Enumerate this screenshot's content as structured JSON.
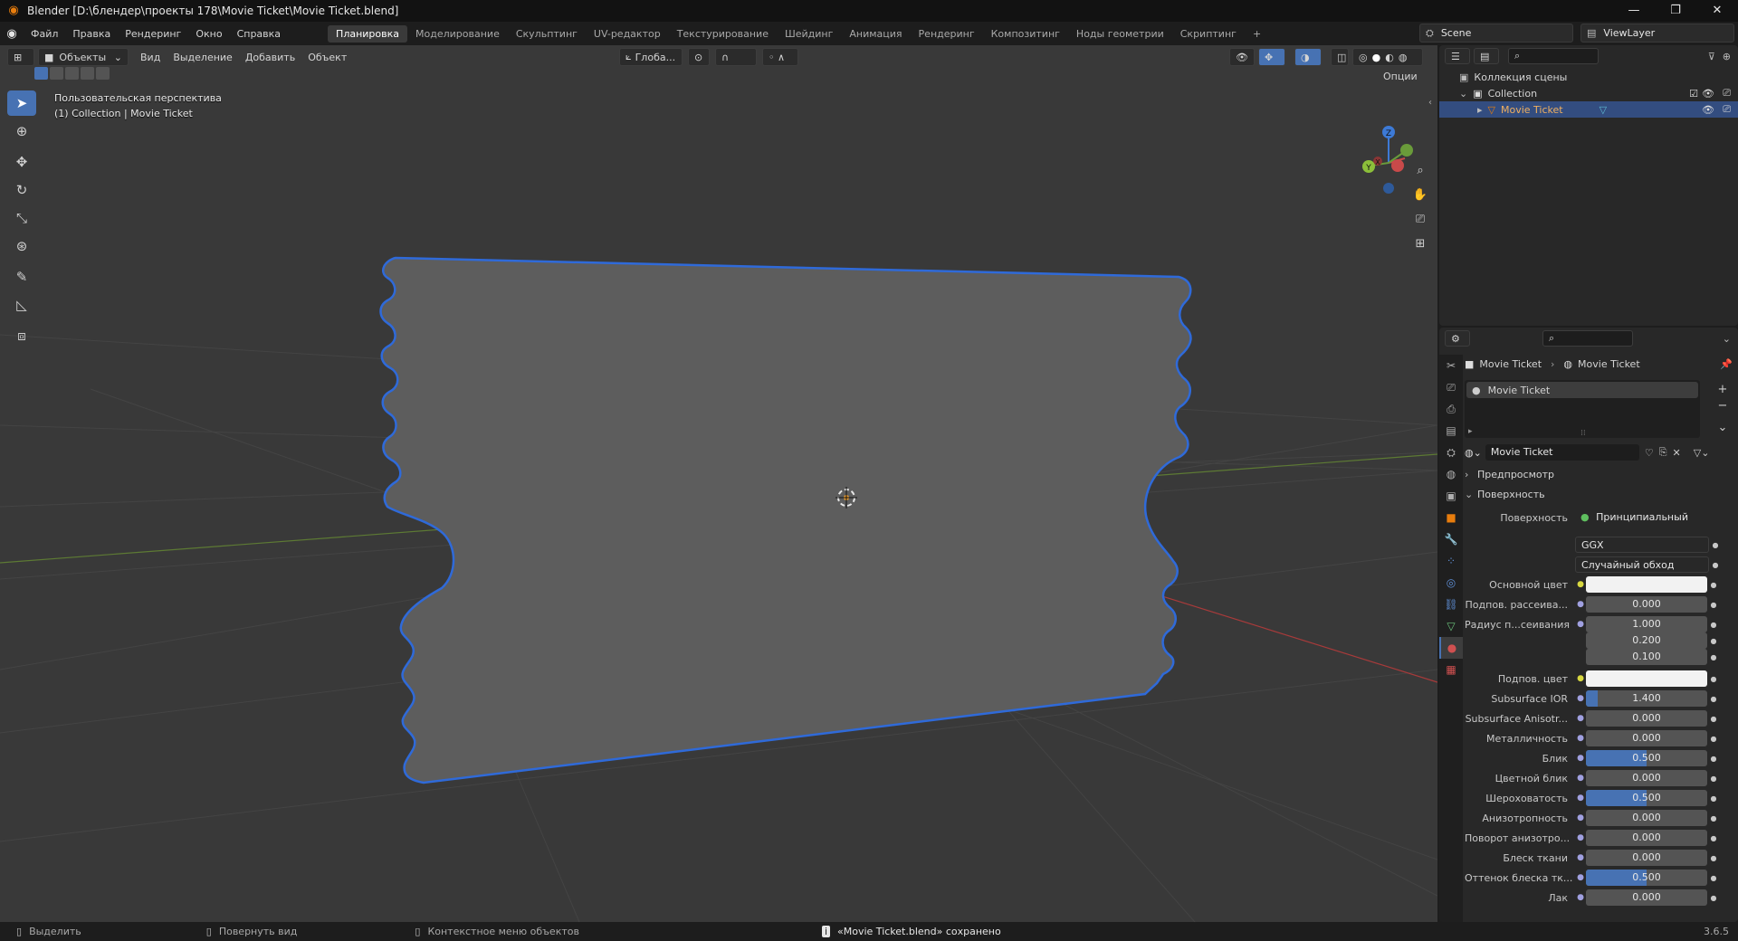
{
  "window": {
    "title": "Blender [D:\\блендер\\проекты 178\\Movie Ticket\\Movie Ticket.blend]",
    "minimize": "—",
    "restore": "❐",
    "close": "✕"
  },
  "menu": [
    "Файл",
    "Правка",
    "Рендеринг",
    "Окно",
    "Справка"
  ],
  "workspaces": [
    {
      "label": "Планировка",
      "active": true
    },
    {
      "label": "Моделирование"
    },
    {
      "label": "Скульптинг"
    },
    {
      "label": "UV-редактор"
    },
    {
      "label": "Текстурирование"
    },
    {
      "label": "Шейдинг"
    },
    {
      "label": "Анимация"
    },
    {
      "label": "Рендеринг"
    },
    {
      "label": "Композитинг"
    },
    {
      "label": "Ноды геометрии"
    },
    {
      "label": "Скриптинг"
    }
  ],
  "add_workspace": "+",
  "scene": {
    "label": "Scene",
    "view_layer": "ViewLayer"
  },
  "viewport": {
    "mode": "Объекты",
    "menus": [
      "Вид",
      "Выделение",
      "Добавить",
      "Объект"
    ],
    "transform_orientation": "Глоба...",
    "options": "Опции",
    "info_line1": "Пользовательская перспектива",
    "info_line2": "(1) Collection | Movie Ticket",
    "gizmo_axes": {
      "z": "Z",
      "x": "X",
      "y": "Y"
    }
  },
  "outliner": {
    "search_placeholder": "",
    "scene_collection": "Коллекция сцены",
    "collection": "Collection",
    "object": "Movie Ticket"
  },
  "properties": {
    "breadcrumb_object": "Movie Ticket",
    "breadcrumb_material": "Movie Ticket",
    "slot": "Movie Ticket",
    "material_name": "Movie Ticket",
    "panel_preview": "Предпросмотр",
    "panel_surface": "Поверхность",
    "surface_label": "Поверхность",
    "surface_value": "Принципиальный BSDF",
    "distribution": "GGX",
    "subsurface_method": "Случайный обход",
    "rows": [
      {
        "label": "Основной цвет",
        "type": "color",
        "color": "#f2f2f2"
      },
      {
        "label": "Подпов. рассеива...",
        "value": "0.000"
      },
      {
        "label": "Радиус п...сеивания",
        "value": "1.000"
      },
      {
        "label": "",
        "value": "0.200"
      },
      {
        "label": "",
        "value": "0.100"
      },
      {
        "label": "Подпов. цвет",
        "type": "color",
        "color": "#f2f2f2"
      },
      {
        "label": "Subsurface IOR",
        "value": "1.400",
        "fill": 0.1
      },
      {
        "label": "Subsurface Anisotr...",
        "value": "0.000"
      },
      {
        "label": "Металличность",
        "value": "0.000"
      },
      {
        "label": "Блик",
        "value": "0.500",
        "fill": 0.5
      },
      {
        "label": "Цветной блик",
        "value": "0.000"
      },
      {
        "label": "Шероховатость",
        "value": "0.500",
        "fill": 0.5
      },
      {
        "label": "Анизотропность",
        "value": "0.000"
      },
      {
        "label": "Поворот анизотро...",
        "value": "0.000"
      },
      {
        "label": "Блеск ткани",
        "value": "0.000"
      },
      {
        "label": "Оттенок блеска тк...",
        "value": "0.500",
        "fill": 0.5
      },
      {
        "label": "Лак",
        "value": "0.000"
      }
    ]
  },
  "status": {
    "select": "Выделить",
    "rotate": "Повернуть вид",
    "context": "Контекстное меню объектов",
    "message": "«Movie Ticket.blend» сохранено",
    "version": "3.6.5"
  },
  "colors": {
    "accent": "#4772b3",
    "selection_outline": "#2f6ad9",
    "ticket_fill": "#5c5c5c",
    "x_axis": "#c94a4a",
    "y_axis": "#6a9b3a",
    "z_axis": "#3d7ad6"
  }
}
